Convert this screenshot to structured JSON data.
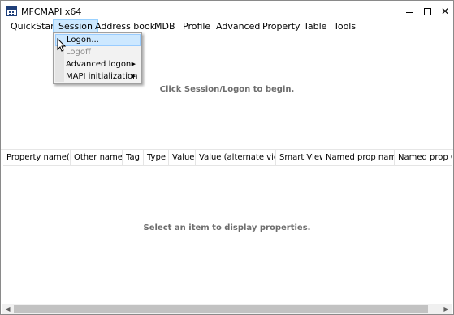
{
  "window": {
    "title": "MFCMAPI x64"
  },
  "titlebar": {
    "minimize_icon": "minimize-icon",
    "maximize_icon": "maximize-icon",
    "close_glyph": "✕"
  },
  "menubar": {
    "items": [
      {
        "label": "QuickStart"
      },
      {
        "label": "Session"
      },
      {
        "label": "Address book"
      },
      {
        "label": "MDB"
      },
      {
        "label": "Profile"
      },
      {
        "label": "Advanced"
      },
      {
        "label": "Property"
      },
      {
        "label": "Table"
      },
      {
        "label": "Tools"
      }
    ]
  },
  "session_menu": {
    "items": [
      {
        "label": "Logon..."
      },
      {
        "label": "Logoff"
      },
      {
        "label": "Advanced logon"
      },
      {
        "label": "MAPI initialization"
      }
    ]
  },
  "upper_pane": {
    "message": "Click Session/Logon to begin."
  },
  "property_list": {
    "columns": [
      "Property name(s)",
      "Other names",
      "Tag",
      "Type",
      "Value",
      "Value (alternate view)",
      "Smart View",
      "Named prop name",
      "Named prop GUID"
    ],
    "empty_message": "Select an item to display properties."
  },
  "colors": {
    "menu_highlight": "#cce8ff",
    "message_text": "#6d6d6d"
  }
}
